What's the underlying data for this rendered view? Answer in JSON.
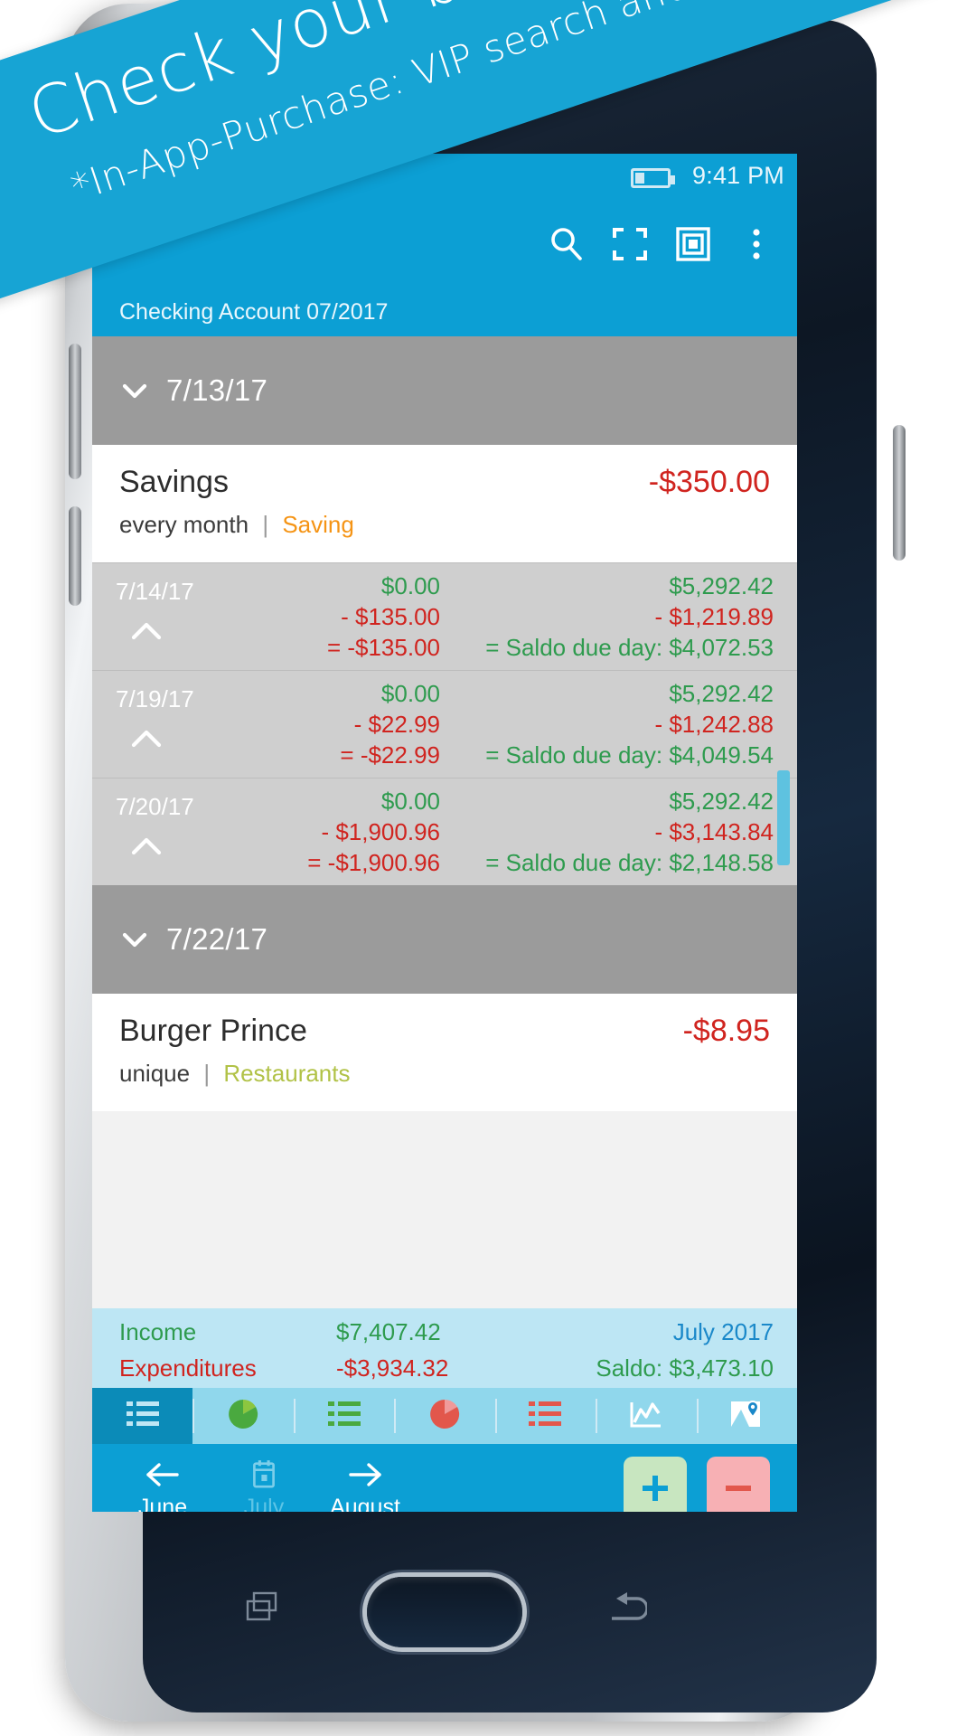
{
  "promo": {
    "headline": "Check your balance by day*",
    "subline": "*In-App-Purchase: VIP search and extended lists",
    "banner_color": "#17a4d4"
  },
  "status_bar": {
    "time": "9:41 PM",
    "battery_icon": "battery-icon"
  },
  "app_bar": {
    "actions": [
      {
        "name": "search-icon",
        "label": "Search"
      },
      {
        "name": "fullscreen-icon",
        "label": "Fullscreen"
      },
      {
        "name": "duplicate-icon",
        "label": "Duplicate"
      },
      {
        "name": "overflow-menu-icon",
        "label": "More options"
      }
    ],
    "subtitle": "Checking Account 07/2017"
  },
  "list": {
    "groups": [
      {
        "date_label": "7/13/17",
        "expanded": true,
        "chevron": "chevron-down-icon",
        "transaction": {
          "title": "Savings",
          "amount": "-$350.00",
          "recurrence": "every month",
          "separator": "|",
          "category": "Saving"
        }
      }
    ],
    "day_rows": [
      {
        "date": "7/14/17",
        "chevron": "chevron-up-icon",
        "income": "$0.00",
        "expense": "- $135.00",
        "total": "= -$135.00",
        "balance_income": "$5,292.42",
        "balance_expense": "- $1,219.89",
        "balance_due": "= Saldo due day: $4,072.53"
      },
      {
        "date": "7/19/17",
        "chevron": "chevron-up-icon",
        "income": "$0.00",
        "expense": "- $22.99",
        "total": "= -$22.99",
        "balance_income": "$5,292.42",
        "balance_expense": "- $1,242.88",
        "balance_due": "= Saldo due day: $4,049.54"
      },
      {
        "date": "7/20/17",
        "chevron": "chevron-up-icon",
        "income": "$0.00",
        "expense": "- $1,900.96",
        "total": "= -$1,900.96",
        "balance_income": "$5,292.42",
        "balance_expense": "- $3,143.84",
        "balance_due": "= Saldo due day: $2,148.58"
      }
    ],
    "group2": {
      "date_label": "7/22/17",
      "chevron": "chevron-down-icon",
      "transaction": {
        "title": "Burger Prince",
        "amount": "-$8.95",
        "recurrence": "unique",
        "separator": "|",
        "category": "Restaurants"
      }
    }
  },
  "summary": {
    "income_label": "Income",
    "income_value": "$7,407.42",
    "period": "July 2017",
    "expenditures_label": "Expenditures",
    "expenditures_value": "-$3,934.32",
    "saldo": "Saldo: $3,473.10"
  },
  "tabs": [
    {
      "name": "tab-list",
      "icon": "list-icon",
      "active": true
    },
    {
      "name": "tab-income-pie",
      "icon": "pie-chart-green-icon",
      "active": false
    },
    {
      "name": "tab-income-list",
      "icon": "list-green-icon",
      "active": false
    },
    {
      "name": "tab-expense-pie",
      "icon": "pie-chart-red-icon",
      "active": false
    },
    {
      "name": "tab-expense-list",
      "icon": "list-red-icon",
      "active": false
    },
    {
      "name": "tab-trend",
      "icon": "line-chart-icon",
      "active": false
    },
    {
      "name": "tab-map",
      "icon": "map-icon",
      "active": false
    }
  ],
  "month_nav": {
    "prev": {
      "label": "June",
      "icon": "arrow-left-icon"
    },
    "current": {
      "label": "July",
      "icon": "calendar-icon"
    },
    "next": {
      "label": "August",
      "icon": "arrow-right-icon"
    },
    "add_label": "+",
    "remove_label": "–"
  },
  "android_nav": [
    {
      "name": "nav-back-icon"
    },
    {
      "name": "nav-home-icon"
    },
    {
      "name": "nav-recents-icon"
    }
  ],
  "colors": {
    "accent": "#0c9fd4",
    "positive": "#2e9b4e",
    "negative": "#d0241f",
    "day_header": "#9b9b9b",
    "day_row": "#cfcfcf",
    "summary_bg": "#bde6f4",
    "category_saving": "#f59415",
    "category_restaurants": "#b1c247"
  }
}
